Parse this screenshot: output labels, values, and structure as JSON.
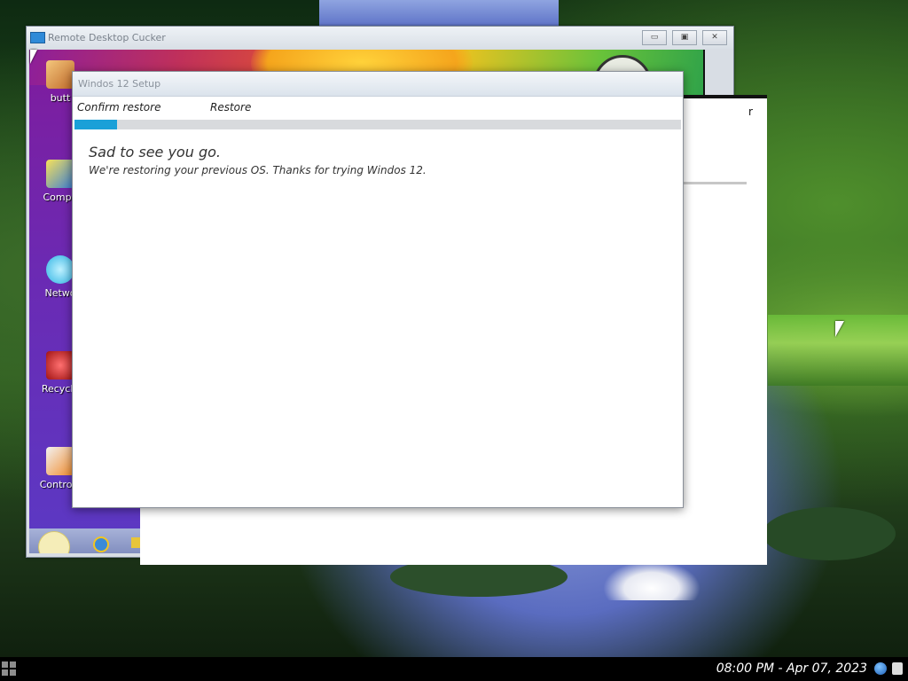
{
  "rdp_window": {
    "title": "Remote Desktop Cucker",
    "controls": {
      "minimize": "▭",
      "restore": "▣",
      "close": "✕"
    },
    "desktop_icons": [
      "butt",
      "Compu",
      "Netwo",
      "Recycle",
      "Control I"
    ]
  },
  "setup_dialog": {
    "title": "Windos 12 Setup",
    "steps": [
      "Confirm restore",
      "Restore"
    ],
    "progress": 0.07,
    "heading": "Sad to see you go.",
    "description": "We're restoring your previous OS. Thanks for trying Windos 12."
  },
  "background_panel": {
    "fragment": "r"
  },
  "taskbar": {
    "clock": "08:00 PM - Apr 07, 2023"
  },
  "colors": {
    "accent": "#1aa0d8",
    "taskbar": "#000000"
  }
}
